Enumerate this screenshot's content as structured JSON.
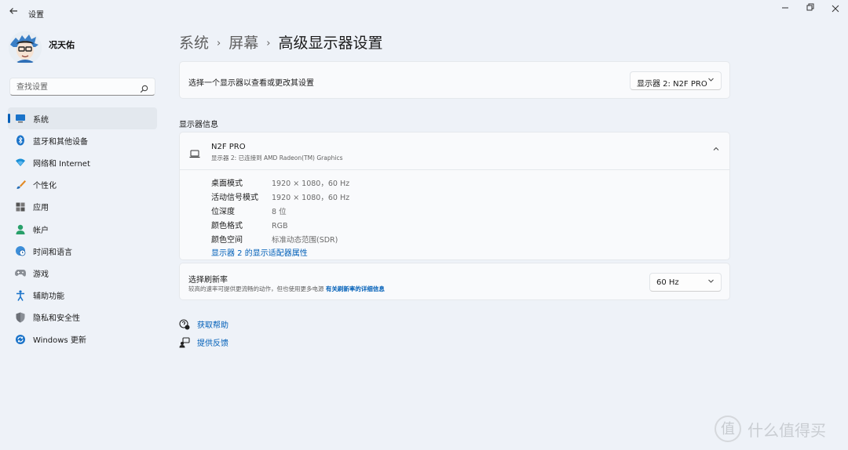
{
  "titlebar": {
    "back_icon": "back-arrow-icon",
    "title": "设置",
    "minimize": "—",
    "maximize": "❐",
    "close": "✕"
  },
  "user": {
    "name": "况天佑",
    "avatar_icon": "avatar-icon"
  },
  "search": {
    "placeholder": "查找设置",
    "value": ""
  },
  "nav": {
    "items": [
      {
        "label": "系统",
        "icon": "system-icon",
        "active": true
      },
      {
        "label": "蓝牙和其他设备",
        "icon": "bluetooth-icon"
      },
      {
        "label": "网络和 Internet",
        "icon": "wifi-icon"
      },
      {
        "label": "个性化",
        "icon": "brush-icon"
      },
      {
        "label": "应用",
        "icon": "apps-icon"
      },
      {
        "label": "帐户",
        "icon": "account-icon"
      },
      {
        "label": "时间和语言",
        "icon": "globe-clock-icon"
      },
      {
        "label": "游戏",
        "icon": "gamepad-icon"
      },
      {
        "label": "辅助功能",
        "icon": "accessibility-icon"
      },
      {
        "label": "隐私和安全性",
        "icon": "shield-icon"
      },
      {
        "label": "Windows 更新",
        "icon": "update-icon"
      }
    ]
  },
  "breadcrumb": {
    "items": [
      "系统",
      "屏幕",
      "高级显示器设置"
    ],
    "separator": "›"
  },
  "display_select": {
    "label": "选择一个显示器以查看或更改其设置",
    "value": "显示器 2: N2F PRO"
  },
  "display_info": {
    "section_title": "显示器信息",
    "monitor_name": "N2F PRO",
    "monitor_sub": "显示器 2: 已连接到 AMD Radeon(TM) Graphics",
    "rows": [
      {
        "key": "桌面模式",
        "value": "1920 × 1080，60 Hz"
      },
      {
        "key": "活动信号模式",
        "value": "1920 × 1080，60 Hz"
      },
      {
        "key": "位深度",
        "value": "8 位"
      },
      {
        "key": "颜色格式",
        "value": "RGB"
      },
      {
        "key": "颜色空间",
        "value": "标准动态范围(SDR)"
      }
    ],
    "adapter_link": "显示器 2 的显示适配器属性"
  },
  "refresh_rate": {
    "label": "选择刷新率",
    "desc": "较高的速率可提供更流畅的动作，但也使用更多电源",
    "link": "有关刷新率的详细信息",
    "value": "60 Hz"
  },
  "help": {
    "get_help": "获取帮助",
    "feedback": "提供反馈"
  },
  "watermark": {
    "text": "什么值得买",
    "logo": "值"
  },
  "colors": {
    "accent": "#005fb8",
    "background": "#eef2f8",
    "card": "#f9fafc"
  }
}
